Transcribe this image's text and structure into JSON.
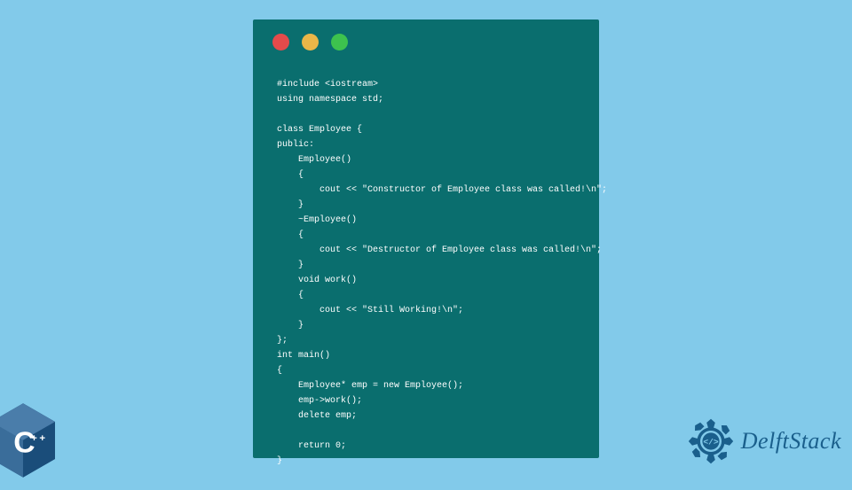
{
  "code": {
    "lines": "#include <iostream>\nusing namespace std;\n\nclass Employee {\npublic:\n    Employee()\n    {\n        cout << \"Constructor of Employee class was called!\\n\";\n    }\n    ~Employee()\n    {\n        cout << \"Destructor of Employee class was called!\\n\";\n    }\n    void work()\n    {\n        cout << \"Still Working!\\n\";\n    }\n};\nint main()\n{\n    Employee* emp = new Employee();\n    emp->work();\n    delete emp;\n\n    return 0;\n}"
  },
  "cpp_logo": {
    "label": "C",
    "plus": "++"
  },
  "delftstack": {
    "text": "DelftStack"
  },
  "colors": {
    "background": "#82caea",
    "window": "#0a6e6e",
    "red": "#e44b4b",
    "yellow": "#eab648",
    "green": "#3dc24e",
    "cpp_blue": "#1a4d7a",
    "delft_blue": "#1a5f8c"
  }
}
